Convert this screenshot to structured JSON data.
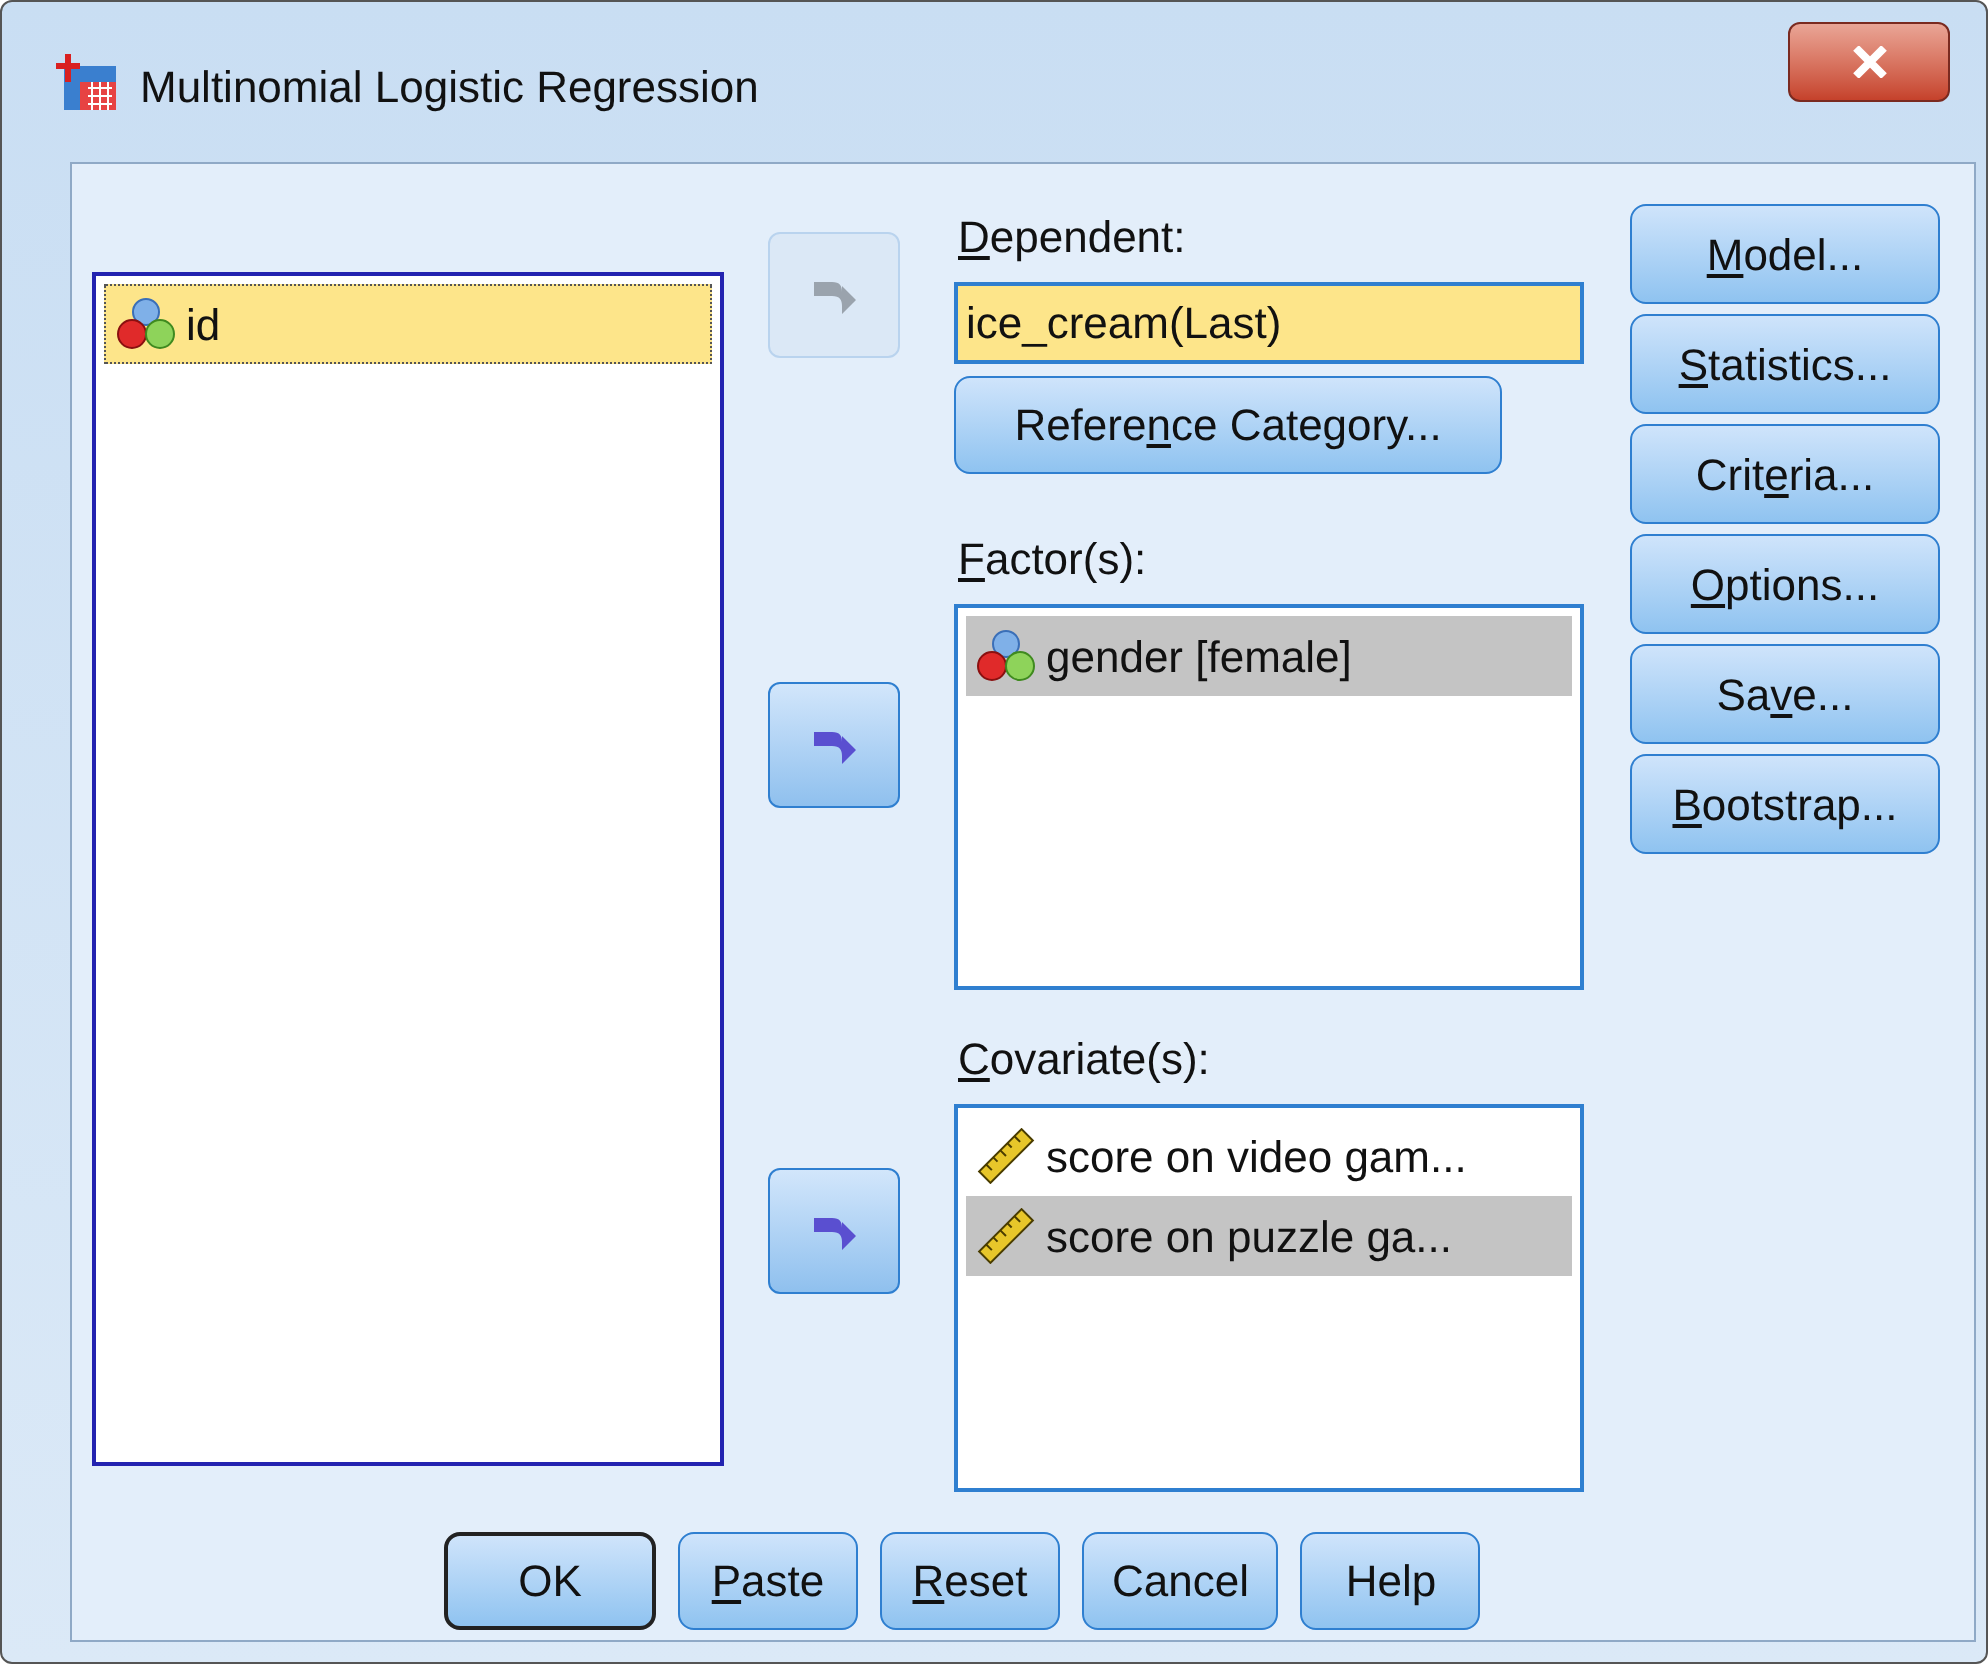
{
  "window": {
    "title": "Multinomial Logistic Regression"
  },
  "source_list": {
    "items": [
      {
        "label": "id",
        "kind": "nominal",
        "selected": true
      }
    ]
  },
  "arrow_buttons": [
    {
      "disabled": true
    },
    {
      "disabled": false
    },
    {
      "disabled": false
    }
  ],
  "dependent": {
    "label": {
      "key": "D",
      "after": "ependent:"
    },
    "value": "ice_cream(Last)"
  },
  "reference_button": {
    "label": {
      "before": "Refere",
      "key": "n",
      "after": "ce Category..."
    }
  },
  "factors": {
    "label": {
      "key": "F",
      "after": "actor(s):"
    },
    "items": [
      {
        "label": "gender [female]",
        "kind": "nominal",
        "selected": true
      }
    ]
  },
  "covariates": {
    "label": {
      "key": "C",
      "after": "ovariate(s):"
    },
    "items": [
      {
        "label": "score on video gam...",
        "kind": "scale",
        "selected": false
      },
      {
        "label": "score on puzzle ga...",
        "kind": "scale",
        "selected": true
      }
    ]
  },
  "side_buttons": [
    {
      "label": {
        "key": "M",
        "after": "odel..."
      }
    },
    {
      "label": {
        "key": "S",
        "after": "tatistics..."
      }
    },
    {
      "label": {
        "before": "Crit",
        "key": "e",
        "after": "ria..."
      }
    },
    {
      "label": {
        "key": "O",
        "after": "ptions..."
      }
    },
    {
      "label": {
        "before": "Sa",
        "key": "v",
        "after": "e..."
      }
    },
    {
      "label": {
        "key": "B",
        "after": "ootstrap..."
      }
    }
  ],
  "bottom_buttons": [
    {
      "label": {
        "text": "OK"
      },
      "default": true
    },
    {
      "label": {
        "key": "P",
        "after": "aste"
      },
      "default": false
    },
    {
      "label": {
        "key": "R",
        "after": "eset"
      },
      "default": false
    },
    {
      "label": {
        "text": "Cancel"
      },
      "default": false
    },
    {
      "label": {
        "text": "Help"
      },
      "default": false
    }
  ]
}
